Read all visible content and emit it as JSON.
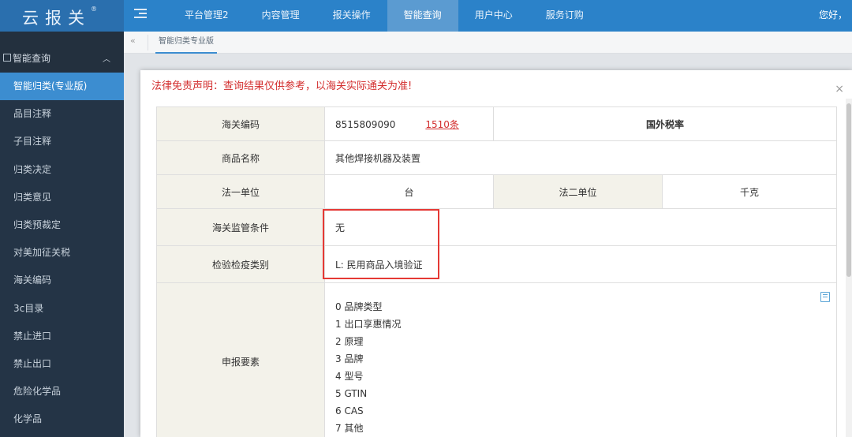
{
  "app": {
    "logo_text": "云报关",
    "logo_mark": "®",
    "greeting": "您好，"
  },
  "nav": {
    "items": [
      "平台管理2",
      "内容管理",
      "报关操作",
      "智能查询",
      "用户中心",
      "服务订购"
    ],
    "active_index": 3
  },
  "sidebar": {
    "group_label": "智能查询",
    "items": [
      "智能归类(专业版)",
      "品目注释",
      "子目注释",
      "归类决定",
      "归类意见",
      "归类预裁定",
      "对美加征关税",
      "海关编码",
      "3c目录",
      "禁止进口",
      "禁止出口",
      "危险化学品",
      "化学品"
    ],
    "active_index": 0
  },
  "tabs": {
    "back_symbol": "«",
    "active_label": "智能归类专业版"
  },
  "modal": {
    "title": "法律免责声明：查询结果仅供参考，以海关实际通关为准!",
    "close_symbol": "×",
    "rows": {
      "hs_code_label": "海关编码",
      "hs_code_value": "8515809090",
      "hs_code_count": "1510条",
      "foreign_rate_label": "国外税率",
      "name_label": "商品名称",
      "name_value": "其他焊接机器及装置",
      "unit1_label": "法一单位",
      "unit1_value": "台",
      "unit2_label": "法二单位",
      "unit2_value": "千克",
      "supervision_label": "海关监管条件",
      "supervision_value": "无",
      "inspection_label": "检验检疫类别",
      "inspection_value": "L: 民用商品入境验证",
      "declaration_label": "申报要素",
      "declaration_items": [
        "0 品牌类型",
        "1 出口享惠情况",
        "2 原理",
        "3 品牌",
        "4 型号",
        "5 GTIN",
        "6 CAS",
        "7 其他"
      ]
    }
  },
  "colors": {
    "topbar": "#2b82c9",
    "sidebar": "#243446",
    "accent": "#3c8dd0",
    "disclaimer_red": "#d32f2f",
    "label_bg": "#f3f2ea",
    "highlight_red": "#e53935"
  }
}
